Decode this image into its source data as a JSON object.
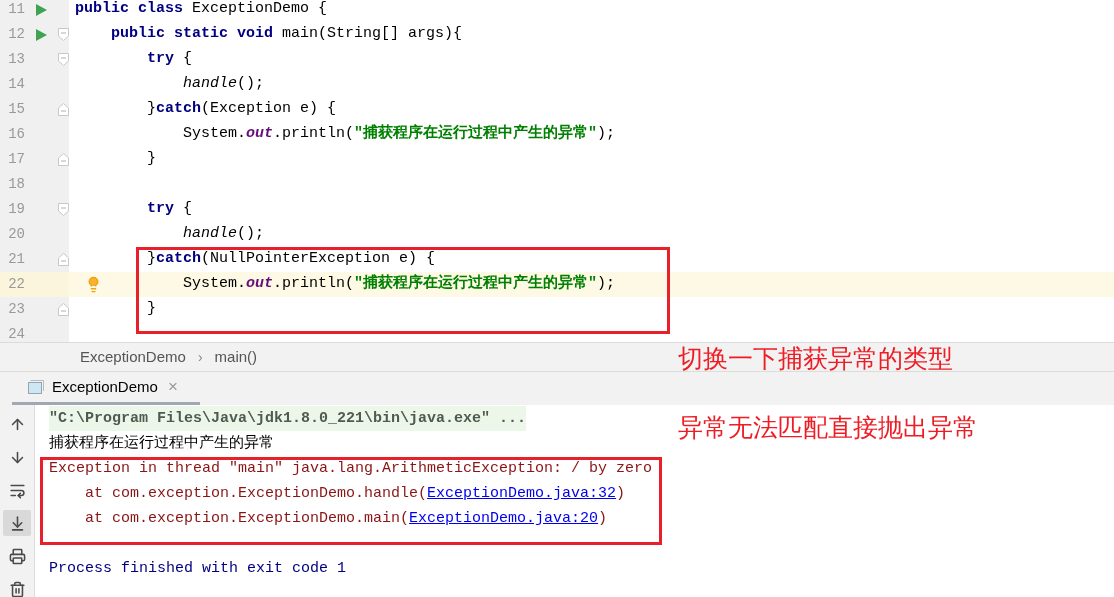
{
  "editor": {
    "lines": [
      {
        "number": "11",
        "run": true,
        "fold_start": false,
        "fold_end": false,
        "highlighted": false,
        "tokens": [
          {
            "kind": "keyword",
            "text": "public class"
          },
          {
            "kind": "plain",
            "text": " ExceptionDemo {"
          }
        ]
      },
      {
        "number": "12",
        "run": true,
        "fold_start": true,
        "fold_end": false,
        "highlighted": false,
        "tokens": [
          {
            "kind": "keyword",
            "text": "    public static void"
          },
          {
            "kind": "plain",
            "text": " main(String[] args){"
          }
        ]
      },
      {
        "number": "13",
        "run": false,
        "fold_start": true,
        "fold_end": false,
        "highlighted": false,
        "tokens": [
          {
            "kind": "keyword",
            "text": "        try"
          },
          {
            "kind": "plain",
            "text": " {"
          }
        ]
      },
      {
        "number": "14",
        "run": false,
        "fold_start": false,
        "fold_end": false,
        "highlighted": false,
        "tokens": [
          {
            "kind": "call",
            "text": "            handle"
          },
          {
            "kind": "plain",
            "text": "();"
          }
        ]
      },
      {
        "number": "15",
        "run": false,
        "fold_start": false,
        "fold_end": true,
        "highlighted": false,
        "tokens": [
          {
            "kind": "plain",
            "text": "        }"
          },
          {
            "kind": "keyword",
            "text": "catch"
          },
          {
            "kind": "plain",
            "text": "(Exception e) {"
          }
        ]
      },
      {
        "number": "16",
        "run": false,
        "fold_start": false,
        "fold_end": false,
        "highlighted": false,
        "tokens": [
          {
            "kind": "plain",
            "text": "            System."
          },
          {
            "kind": "field",
            "text": "out"
          },
          {
            "kind": "plain",
            "text": ".println("
          },
          {
            "kind": "string",
            "text": "\"捕获程序在运行过程中产生的异常\""
          },
          {
            "kind": "plain",
            "text": ");"
          }
        ]
      },
      {
        "number": "17",
        "run": false,
        "fold_start": false,
        "fold_end": true,
        "highlighted": false,
        "tokens": [
          {
            "kind": "plain",
            "text": "        }"
          }
        ]
      },
      {
        "number": "18",
        "run": false,
        "fold_start": false,
        "fold_end": false,
        "highlighted": false
      },
      {
        "number": "19",
        "run": false,
        "fold_start": true,
        "fold_end": false,
        "highlighted": false,
        "tokens": [
          {
            "kind": "keyword",
            "text": "        try"
          },
          {
            "kind": "plain",
            "text": " {"
          }
        ]
      },
      {
        "number": "20",
        "run": false,
        "fold_start": false,
        "fold_end": false,
        "highlighted": false,
        "tokens": [
          {
            "kind": "call",
            "text": "            handle"
          },
          {
            "kind": "plain",
            "text": "();"
          }
        ]
      },
      {
        "number": "21",
        "run": false,
        "fold_start": false,
        "fold_end": true,
        "highlighted": false,
        "tokens": [
          {
            "kind": "plain",
            "text": "        }"
          },
          {
            "kind": "keyword",
            "text": "catch"
          },
          {
            "kind": "plain",
            "text": "(NullPointerException e) {"
          }
        ]
      },
      {
        "number": "22",
        "run": false,
        "fold_start": false,
        "fold_end": false,
        "highlighted": true,
        "bulb": true,
        "tokens": [
          {
            "kind": "plain",
            "text": "            System."
          },
          {
            "kind": "field",
            "text": "out"
          },
          {
            "kind": "plain",
            "text": ".println("
          },
          {
            "kind": "string",
            "text": "\"捕获程序在运行过程中产生的异常\""
          },
          {
            "kind": "plain",
            "text": ");"
          }
        ]
      },
      {
        "number": "23",
        "run": false,
        "fold_start": false,
        "fold_end": true,
        "highlighted": false,
        "tokens": [
          {
            "kind": "plain",
            "text": "        }"
          }
        ]
      },
      {
        "number": "24",
        "run": false,
        "fold_start": false,
        "fold_end": false,
        "highlighted": false
      }
    ]
  },
  "breadcrumb": {
    "items": [
      "ExceptionDemo",
      "main()"
    ],
    "separator": "›"
  },
  "run_tabs": [
    {
      "label": "ExceptionDemo",
      "selected": true,
      "close": "×"
    }
  ],
  "console_toolbar": [
    {
      "kind": "up",
      "selected": false
    },
    {
      "kind": "down",
      "selected": false
    },
    {
      "kind": "wrap",
      "selected": false
    },
    {
      "kind": "scroll-end",
      "selected": true
    },
    {
      "kind": "print",
      "selected": false
    },
    {
      "kind": "trash",
      "selected": false
    }
  ],
  "console": [
    {
      "kind": "command",
      "text": "\"C:\\Program Files\\Java\\jdk1.8.0_221\\bin\\java.exe\" ..."
    },
    {
      "kind": "output",
      "text": "捕获程序在运行过程中产生的异常"
    },
    {
      "kind": "error",
      "text": "Exception in thread \"main\" java.lang.ArithmeticException: / by zero"
    },
    {
      "kind": "trace",
      "text": "    at com.exception.ExceptionDemo.handle(",
      "link": "ExceptionDemo.java:32",
      "suffix": ")"
    },
    {
      "kind": "trace",
      "text": "    at com.exception.ExceptionDemo.main(",
      "link": "ExceptionDemo.java:20",
      "suffix": ")"
    },
    {
      "kind": "exit",
      "text": "Process finished with exit code 1"
    }
  ],
  "annotations": [
    "切换一下捕获异常的类型",
    "异常无法匹配直接抛出异常"
  ]
}
